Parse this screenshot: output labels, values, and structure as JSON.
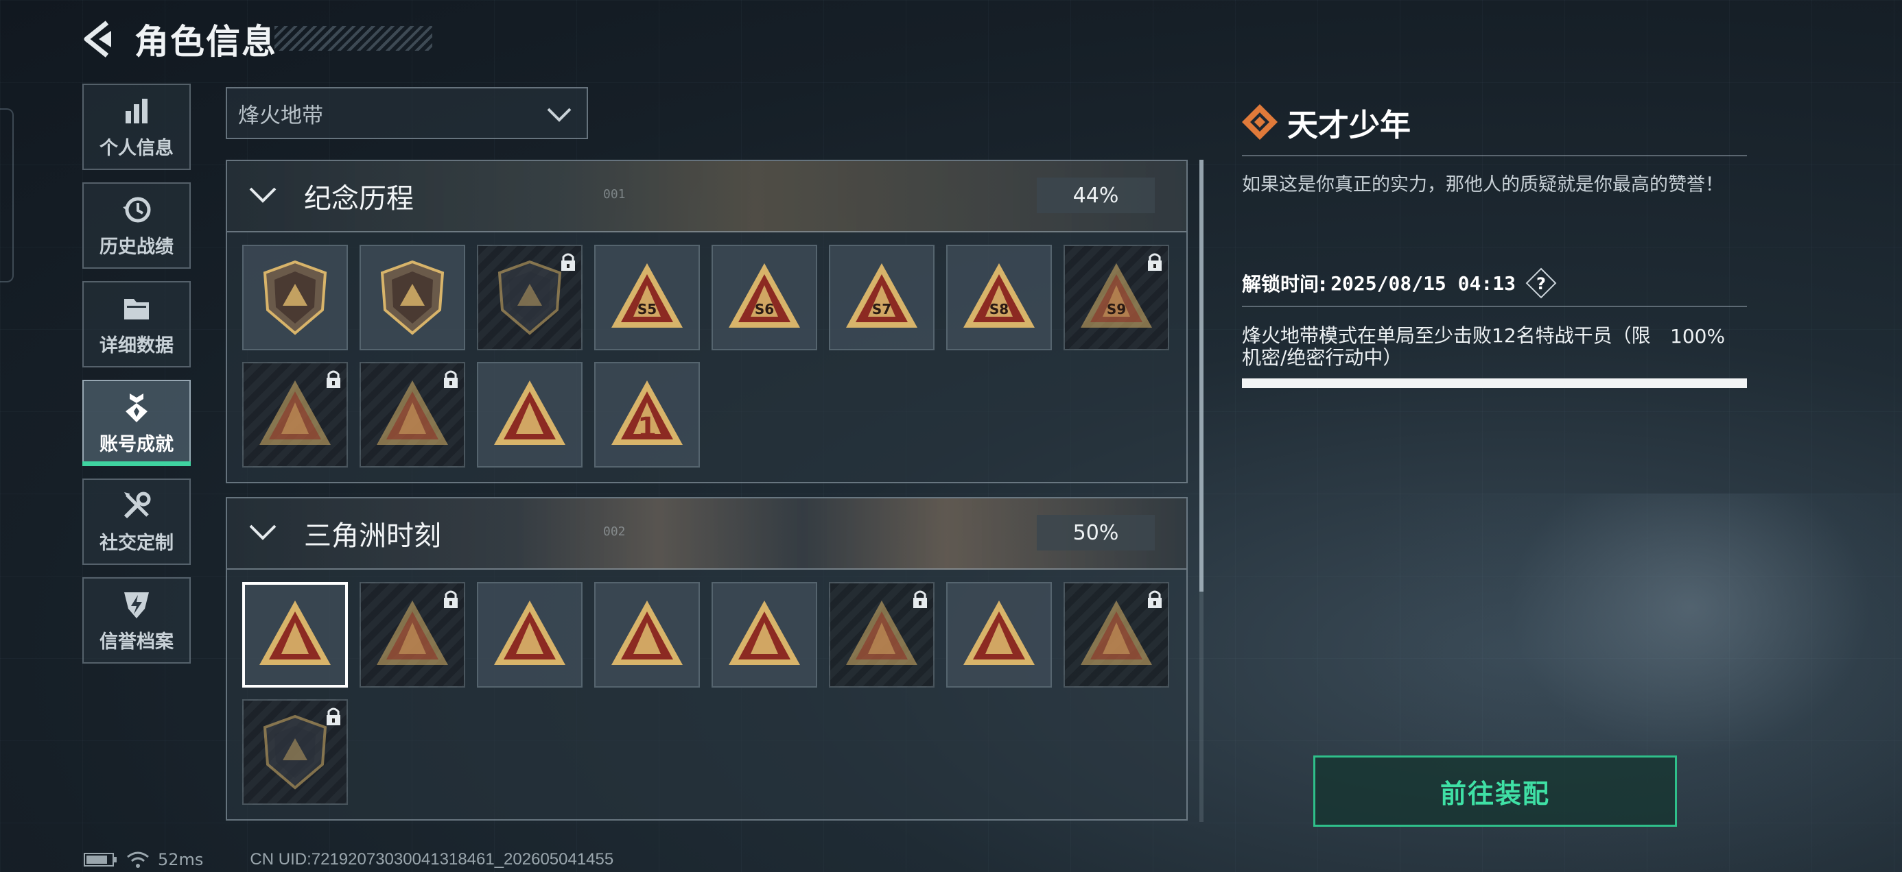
{
  "header": {
    "title": "角色信息"
  },
  "sidebar": {
    "items": [
      {
        "label": "个人信息",
        "icon": "bar-chart-icon"
      },
      {
        "label": "历史战绩",
        "icon": "history-clock-icon"
      },
      {
        "label": "详细数据",
        "icon": "folder-icon"
      },
      {
        "label": "账号成就",
        "icon": "medal-icon",
        "active": true
      },
      {
        "label": "社交定制",
        "icon": "tools-icon"
      },
      {
        "label": "信誉档案",
        "icon": "shield-bolt-icon"
      }
    ]
  },
  "mode_select": {
    "value": "烽火地带"
  },
  "sections": [
    {
      "name": "纪念历程",
      "code": "001",
      "percent": "44%",
      "badges": [
        {
          "icon": "mountain-shield-badge",
          "locked": false,
          "label": ""
        },
        {
          "icon": "helicopter-shield-badge",
          "locked": false,
          "label": ""
        },
        {
          "icon": "dark-emblem-badge",
          "locked": true,
          "label": ""
        },
        {
          "icon": "season-bag-badge",
          "locked": false,
          "label": "S5"
        },
        {
          "icon": "season-mask-badge",
          "locked": false,
          "label": "S6"
        },
        {
          "icon": "season-box-badge",
          "locked": false,
          "label": "S7"
        },
        {
          "icon": "season-pack-badge",
          "locked": false,
          "label": "S8"
        },
        {
          "icon": "season-plane-badge",
          "locked": true,
          "label": "S9"
        },
        {
          "icon": "hooded-figure-badge",
          "locked": true,
          "label": ""
        },
        {
          "icon": "crossed-swords-badge",
          "locked": true,
          "label": ""
        },
        {
          "icon": "sunrise-badge",
          "locked": false,
          "label": ""
        },
        {
          "icon": "number-one-badge",
          "locked": false,
          "label": "1"
        }
      ]
    },
    {
      "name": "三角洲时刻",
      "code": "002",
      "percent": "50%",
      "badges": [
        {
          "icon": "usb-drive-badge",
          "locked": false,
          "selected": true,
          "label": ""
        },
        {
          "icon": "device-badge",
          "locked": true,
          "label": ""
        },
        {
          "icon": "operator-badge",
          "locked": false,
          "label": ""
        },
        {
          "icon": "gear-hands-badge",
          "locked": false,
          "label": ""
        },
        {
          "icon": "squad-badge",
          "locked": false,
          "label": ""
        },
        {
          "icon": "team-badge",
          "locked": true,
          "label": ""
        },
        {
          "icon": "rocket-badge",
          "locked": false,
          "label": ""
        },
        {
          "icon": "dragon-badge",
          "locked": true,
          "label": ""
        },
        {
          "icon": "cube-diamond-badge",
          "locked": true,
          "label": ""
        }
      ]
    }
  ],
  "detail": {
    "title": "天才少年",
    "description": "如果这是你真正的实力，那他人的质疑就是你最高的赞誉！",
    "unlock_label": "解锁时间:",
    "unlock_time": "2025/08/15 04:13",
    "condition": "烽火地带模式在单局至少击败12名特战干员（限机密/绝密行动中）",
    "condition_percent": "100%",
    "progress": 1.0,
    "equip_button": "前往装配"
  },
  "status": {
    "ping": "52ms",
    "uid": "CN UID:72192073030041318461_202605041455"
  },
  "colors": {
    "accent": "#3fd3a0",
    "badge_gold": "#d8b46a",
    "badge_red": "#8c2a22",
    "detail_icon": "#e07a3a"
  }
}
